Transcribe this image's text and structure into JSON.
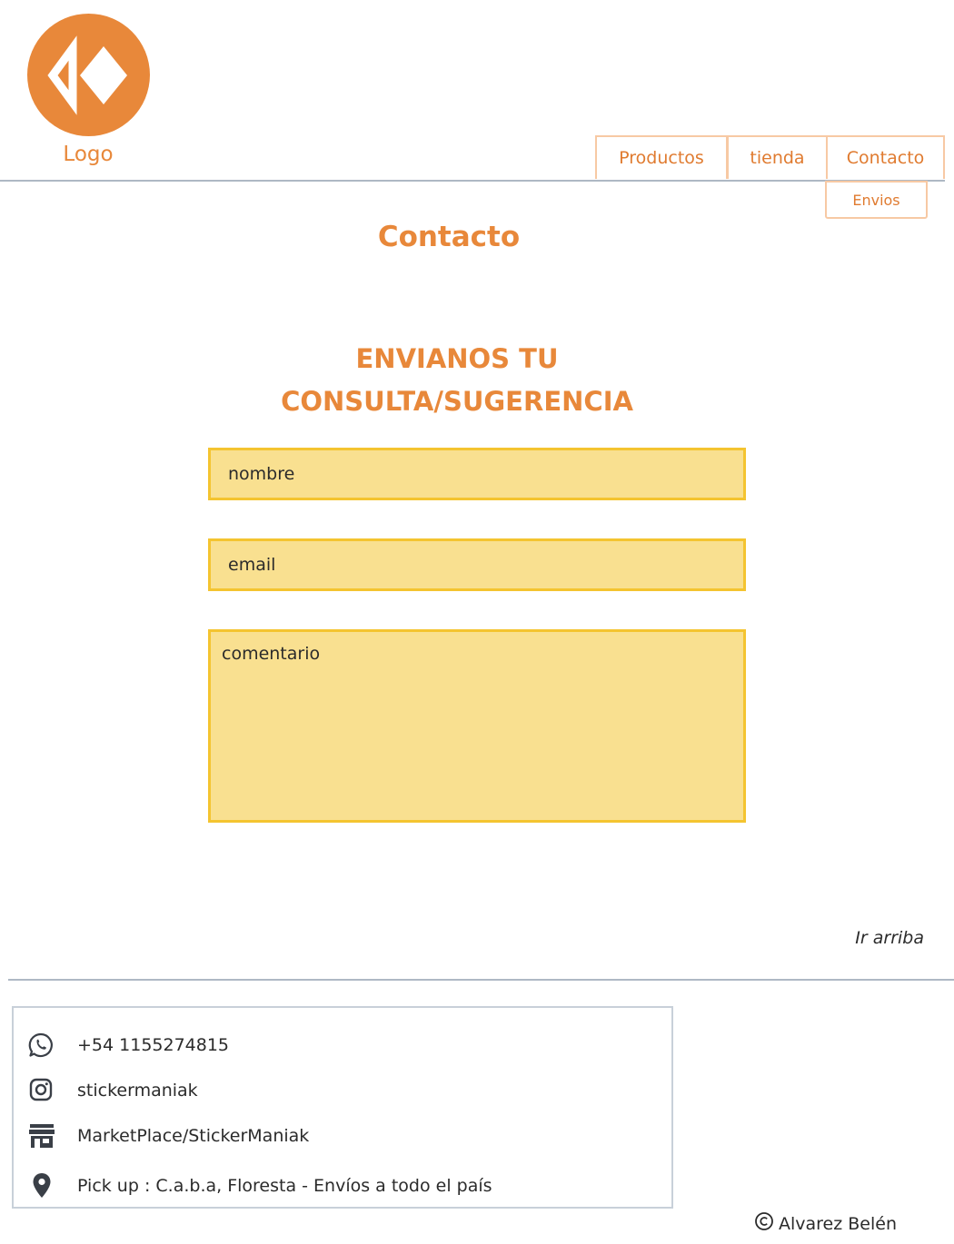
{
  "header": {
    "logo_text": "Logo",
    "brand_color": "#e8883a",
    "nav": {
      "productos": "Productos",
      "tienda": "tienda",
      "contacto": "Contacto",
      "sub_envios": "Envios"
    }
  },
  "main": {
    "page_title": "Contacto",
    "form_heading_line1": "ENVIANOS TU",
    "form_heading_line2": "CONSULTA/SUGERENCIA",
    "form": {
      "nombre_placeholder": "nombre",
      "email_placeholder": "email",
      "comentario_placeholder": "comentario",
      "field_bg": "#f9e090",
      "field_border": "#f4c430"
    },
    "ir_arriba": "Ir arriba"
  },
  "footer": {
    "contacts": [
      {
        "icon": "whatsapp-icon",
        "text": "+54 1155274815"
      },
      {
        "icon": "instagram-icon",
        "text": "stickermaniak"
      },
      {
        "icon": "store-icon",
        "text": "MarketPlace/StickerManiak"
      },
      {
        "icon": "location-pin-icon",
        "text": "Pick up : C.a.b.a, Floresta - Envíos a todo el país"
      }
    ],
    "copyright": "Alvarez Belén"
  }
}
